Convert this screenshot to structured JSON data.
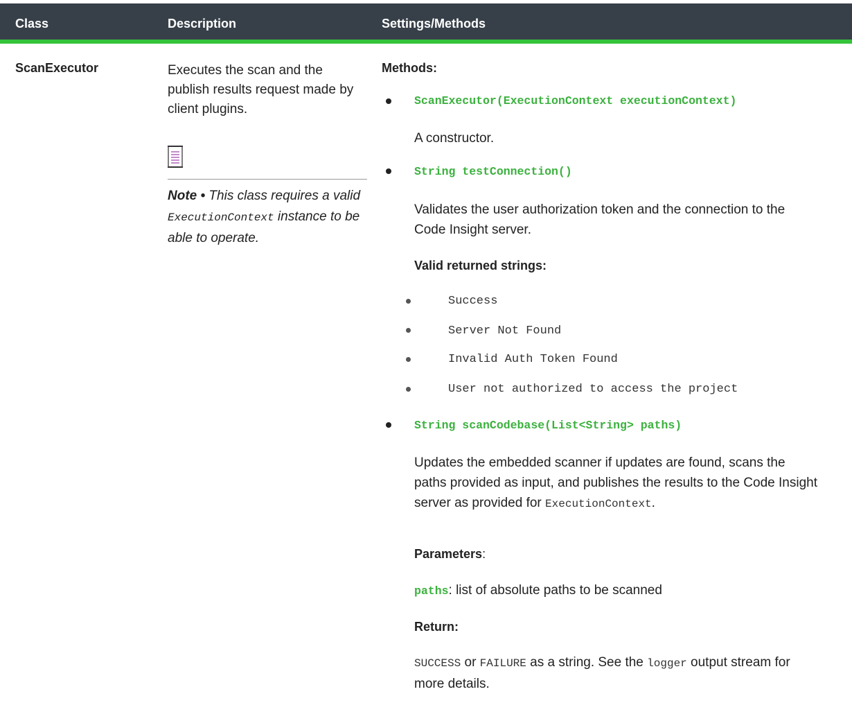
{
  "header": {
    "col_class": "Class",
    "col_description": "Description",
    "col_settings": "Settings/Methods"
  },
  "row": {
    "class_name": "ScanExecutor",
    "description": "Executes the scan and the publish results request made by client plugins.",
    "note": {
      "icon": "note-icon",
      "lead": "Note •",
      "text_a": " This class requires a valid ",
      "code": "ExecutionContext",
      "text_b": " instance to be able to operate."
    },
    "settings": {
      "methods_heading": "Methods:",
      "m1_signature": "ScanExecutor(ExecutionContext executionContext)",
      "m1_desc": "A constructor.",
      "m2_signature": "String testConnection()",
      "m2_desc": "Validates the user authorization token and the connection to the Code Insight server.",
      "valid_heading": "Valid returned strings:",
      "valid_strings": [
        "Success",
        "Server Not Found",
        "Invalid Auth Token Found",
        "User not authorized to access the project"
      ],
      "m3_signature": "String scanCodebase(List<String> paths)",
      "m3_desc": "Updates the embedded scanner if updates are found, scans the paths provided as input, and publishes the results to the Code Insight server as provided for ",
      "m3_desc_code": "ExecutionContext",
      "m3_desc_end": ".",
      "params_heading": "Parameters",
      "params_colon": ":",
      "param_name": "paths",
      "param_desc": ": list of absolute paths to be scanned",
      "return_heading": "Return:",
      "return_success": "SUCCESS",
      "return_or": " or ",
      "return_failure": "FAILURE",
      "return_text_a": " as a string. See the ",
      "return_logger": "logger",
      "return_text_b": " output stream for more details."
    }
  }
}
